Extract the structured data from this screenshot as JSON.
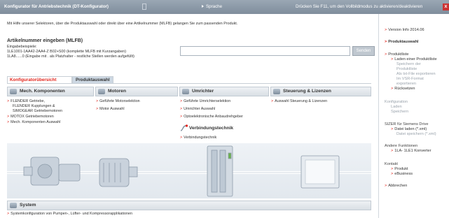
{
  "topbar": {
    "title": "Konfigurator für Antriebstechnik (DT-Konfigurator)",
    "language": "Sprache",
    "fullscreen_hint": "Drücken Sie F11, um den Vollbildmodus zu aktivieren/deaktivieren",
    "close": "x"
  },
  "intro": "Mit Hilfe unserer Selektoren, über die Produktauswahl oder direkt über eine Artikelnummer (MLFB) gelangen Sie zum passenden Produkt.",
  "mlfb": {
    "title": "Artikelnummer eingeben (MLFB)",
    "examples_label": "Eingabebeispiele:",
    "example1": "1LE1001-1AA42-2AA4-Z B02+S00 (komplette MLFB mit Kurzangaben)",
    "example2": "1LA8......0 (Eingabe mit . als Platzhalter - restliche Stellen werden aufgefüllt)",
    "input_value": "",
    "button": "Senden"
  },
  "tabs": [
    "Konfiguratorübersicht",
    "Produktauswahl"
  ],
  "categories": {
    "mech": {
      "title": "Mech. Komponenten",
      "links": [
        "FLENDER Getriebe,",
        "FLENDER Kupplungen &",
        "SIMOGEAR Getriebemotoren",
        "MOTOX Getriebemotoren",
        "Mech. Komponenten Auswahl"
      ]
    },
    "motoren": {
      "title": "Motoren",
      "links": [
        "Geführte Motorselektion",
        "Motor Auswahl"
      ]
    },
    "umrichter": {
      "title": "Umrichter",
      "links": [
        "Geführte Umrichterselektion",
        "Umrichter Auswahl",
        "Optoelektronische Anbaudrehgeber"
      ]
    },
    "verbindung": {
      "title": "Verbindungstechnik",
      "links": [
        "Verbindungstechnik"
      ]
    },
    "steuerung": {
      "title": "Steuerung & Lizenzen",
      "links": [
        "Auswahl Steuerung & Lizenzen"
      ]
    },
    "system": {
      "title": "System",
      "links": [
        "Systemkonfiguration von Pumpen-, Lüfter- und Kompressorapplikationen"
      ]
    }
  },
  "right_panel": {
    "version": "Version Info 2014.06",
    "produktauswahl": "Produktauswahl",
    "produktliste": "Produktliste",
    "laden": "Laden einer Produktliste",
    "speichern1": "Speichern der",
    "speichern2": "Produktliste",
    "export1": "Als txt-File exportieren",
    "export2": "Im VSR-Format",
    "export3": "exportieren",
    "ruecksetzen": "Rücksetzen",
    "konfiguration": "Konfiguration",
    "k_laden": "Laden",
    "k_speichern": "Speichern",
    "sizer": "SIZER für Siemens Drive",
    "datei_laden": "Datei laden (*.xml)",
    "datei_speichern": "Datei speichern (*.xml)",
    "andere": "Andere Funktionen",
    "konverter": "1LA- 1LE1 Konverter",
    "kontakt": "Kontakt",
    "produkt": "Produkt",
    "ebusiness": "eBusiness",
    "abbrechen": "Abbrechen"
  },
  "colors": {
    "accent": "#e2231a",
    "topbar": "#8896a5",
    "tab_active": "#e2231a"
  }
}
